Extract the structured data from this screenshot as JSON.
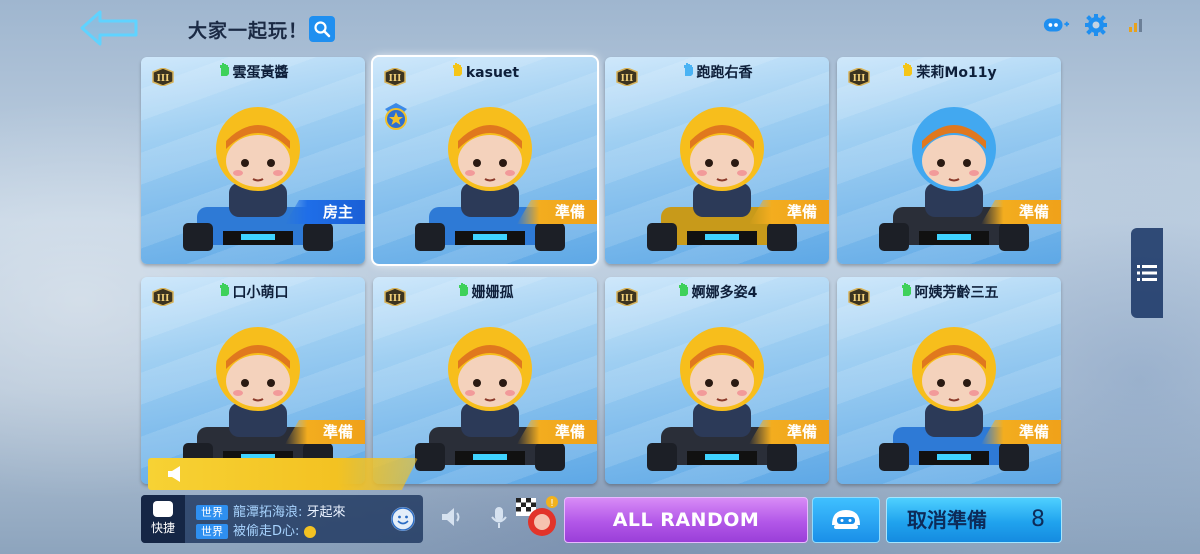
{
  "header": {
    "room_title": "大家一起玩！",
    "icons": [
      "back-arrow-icon",
      "search-icon",
      "add-friend-icon",
      "gear-icon",
      "signal-icon"
    ]
  },
  "players": [
    {
      "name": "雲蛋黃醬",
      "status": "房主",
      "status_kind": "host",
      "rank": "III",
      "hand_color": "#3ed15a",
      "selected": false
    },
    {
      "name": "kasuet",
      "status": "準備",
      "status_kind": "ready",
      "rank": "III",
      "hand_color": "#f5c518",
      "selected": true
    },
    {
      "name": "跑跑右香",
      "status": "準備",
      "status_kind": "ready",
      "rank": "III",
      "hand_color": "#4ab3f4",
      "selected": false
    },
    {
      "name": "茉莉Mo11y",
      "status": "準備",
      "status_kind": "ready",
      "rank": "III",
      "hand_color": "#f5c518",
      "selected": false
    },
    {
      "name": "口小萌口",
      "status": "準備",
      "status_kind": "ready",
      "rank": "III",
      "hand_color": "#3ed15a",
      "selected": false
    },
    {
      "name": "姗姗孤",
      "status": "準備",
      "status_kind": "ready",
      "rank": "III",
      "hand_color": "#3ed15a",
      "selected": false
    },
    {
      "name": "婀娜多姿4",
      "status": "準備",
      "status_kind": "ready",
      "rank": "III",
      "hand_color": "#3ed15a",
      "selected": false
    },
    {
      "name": "阿姨芳齡三五",
      "status": "準備",
      "status_kind": "ready",
      "rank": "III",
      "hand_color": "#3ed15a",
      "selected": false
    }
  ],
  "chat": {
    "quick_label": "快捷",
    "lines": [
      {
        "channel": "世界",
        "sender": "龍潭拓海浪:",
        "message": "牙起來"
      },
      {
        "channel": "世界",
        "sender": "被偷走D心:",
        "message": ""
      }
    ]
  },
  "buttons": {
    "all_random": "ALL RANDOM",
    "cancel_ready": "取消準備",
    "cancel_count": "8"
  },
  "colors": {
    "ready_tag": "#f3ad1f",
    "host_tag": "#1f6ee8",
    "all_random": "#b257e8",
    "cancel": "#20a3ee"
  }
}
